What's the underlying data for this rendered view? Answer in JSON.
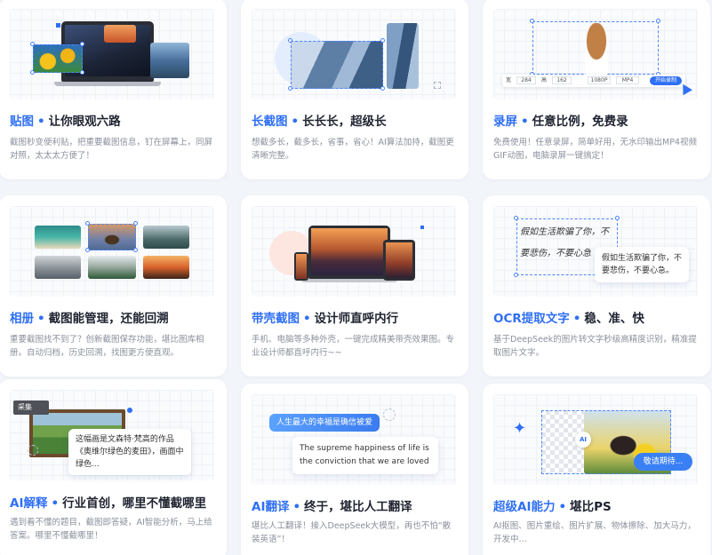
{
  "cards": [
    {
      "title_hl": "贴图",
      "title_rest": "让你眼观六路",
      "desc": "截图秒变便利贴，把重要截图信息，钉在屏幕上，同屏对照，太太太方便了！"
    },
    {
      "title_hl": "长截图",
      "title_rest": "长长长，超级长",
      "desc": "想截多长，截多长，省事，省心！AI算法加持，截图更清晰完整。"
    },
    {
      "title_hl": "录屏",
      "title_rest": "任意比例，免费录",
      "desc": "免费使用！任意录屏，简单好用，无水印输出MP4视频GIF动图，电脑录屏一键搞定！"
    },
    {
      "title_hl": "相册",
      "title_rest": "截图能管理，还能回溯",
      "desc": "重要截图找不到了？创新截图保存功能，堪比图库相册。自动归档，历史回溯，找图更方便直观。"
    },
    {
      "title_hl": "带壳截图",
      "title_rest": "设计师直呼内行",
      "desc": "手机、电脑等多种外壳，一键完成精美带壳效果图。专业设计师都直呼内行~~"
    },
    {
      "title_hl": "OCR提取文字",
      "title_rest": "稳、准、快",
      "desc": "基于DeepSeek的图片转文字秒级高精度识别，精准提取图片文字。"
    },
    {
      "title_hl": "AI解释",
      "title_rest": "行业首创，哪里不懂截哪里",
      "desc": "遇到看不懂的题目，截图即答疑，AI智能分析，马上给答案。哪里不懂截哪里！"
    },
    {
      "title_hl": "AI翻译",
      "title_rest": "终于，堪比人工翻译",
      "desc": "堪比人工翻译！接入DeepSeek大模型，再也不怕“散装英语”！"
    },
    {
      "title_hl": "超级AI能力",
      "title_rest": "堪比PS",
      "desc": "AI抠图、图片重绘、图片扩展、物体擦除、加大马力，开发中…"
    }
  ],
  "dot": "•",
  "record_toolbar": {
    "w_label": "宽",
    "w_value": "284",
    "h_label": "高",
    "h_value": "162",
    "quality": "1080P",
    "format": "MP4",
    "start_label": "开始录制"
  },
  "ocr": {
    "handwriting": "假如生活欺骗了你，不要悲伤，不要心急",
    "result": "假如生活欺骗了你，不要悲伤，不要心急。"
  },
  "ai_explain": {
    "tag": "采集",
    "bubble": "这幅画是文森特·梵高的作品《奥维尔绿色的麦田》，画面中绿色..."
  },
  "ai_translate": {
    "source": "人生最大的幸福是确信被爱",
    "target": "The supreme happiness of life is the conviction that we are loved"
  },
  "super_ai": {
    "badge": "AI",
    "bubble": "敬请期待..."
  },
  "colors": {
    "accent": "#2f6ff5",
    "title": "#1e2330",
    "desc": "#8a909c"
  }
}
